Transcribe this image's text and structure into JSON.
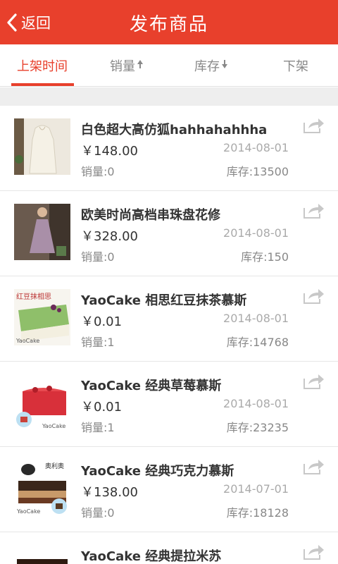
{
  "header": {
    "back_label": "返回",
    "title": "发布商品",
    "brand_color": "#e8402c"
  },
  "tabs": [
    {
      "label": "上架时间",
      "active": true
    },
    {
      "label": "销量",
      "sort": "up"
    },
    {
      "label": "库存",
      "sort": "down"
    },
    {
      "label": "下架"
    }
  ],
  "items": [
    {
      "name": "白色超大高仿狐hahhahahhha",
      "price": "￥148.00",
      "date": "2014-08-01",
      "sales": "销量:0",
      "stock": "库存:13500"
    },
    {
      "name": "欧美时尚高档串珠盘花修",
      "price": "￥328.00",
      "date": "2014-08-01",
      "sales": "销量:0",
      "stock": "库存:150"
    },
    {
      "name": "YaoCake 相思红豆抹茶慕斯",
      "price": "￥0.01",
      "date": "2014-08-01",
      "sales": "销量:1",
      "stock": "库存:14768",
      "image_text": "红豆抹相思",
      "image_brand": "YaoCake"
    },
    {
      "name": "YaoCake 经典草莓慕斯",
      "price": "￥0.01",
      "date": "2014-08-01",
      "sales": "销量:1",
      "stock": "库存:23235",
      "image_brand": "YaoCake"
    },
    {
      "name": "YaoCake 经典巧克力慕斯",
      "price": "￥138.00",
      "date": "2014-07-01",
      "sales": "销量:0",
      "stock": "库存:18128",
      "image_text": "奥利奥",
      "image_brand": "YaoCake"
    },
    {
      "name": "YaoCake 经典提拉米苏"
    }
  ]
}
